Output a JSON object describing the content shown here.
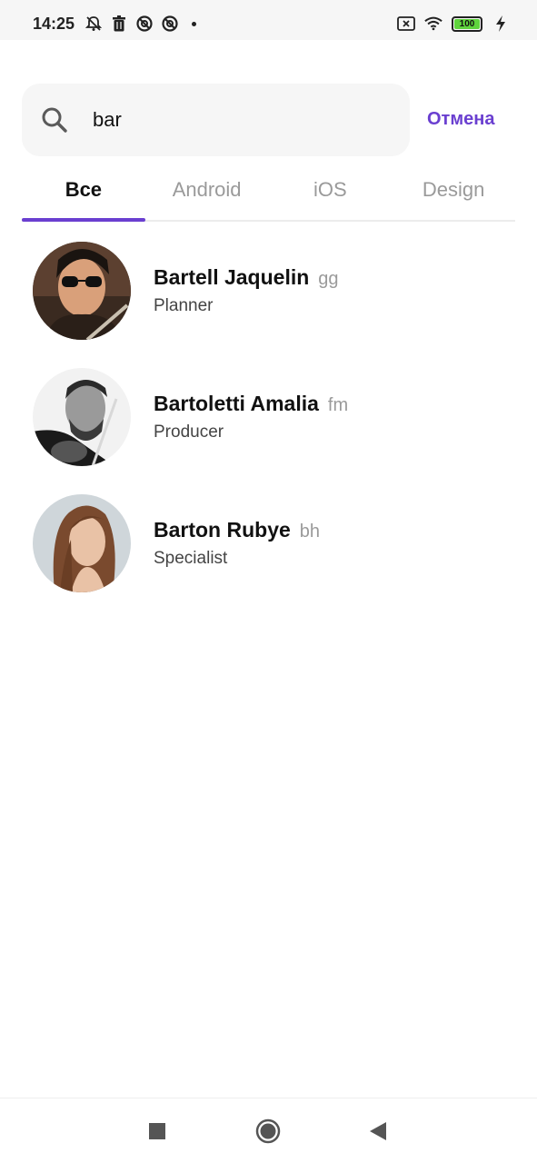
{
  "status_bar": {
    "time": "14:25",
    "battery_level": "100",
    "left_icons": [
      "bell-off-icon",
      "trash-icon",
      "notification-icon",
      "notification-icon"
    ],
    "right_icons": [
      "sim-off-icon",
      "wifi-icon",
      "battery-icon",
      "charging-icon"
    ]
  },
  "search": {
    "value": "bar",
    "cancel_label": "Отмена"
  },
  "tabs": [
    {
      "label": "Все",
      "active": true
    },
    {
      "label": "Android",
      "active": false
    },
    {
      "label": "iOS",
      "active": false
    },
    {
      "label": "Design",
      "active": false
    }
  ],
  "contacts": [
    {
      "name": "Bartell Jaquelin",
      "handle": "gg",
      "role": "Planner"
    },
    {
      "name": "Bartoletti Amalia",
      "handle": "fm",
      "role": "Producer"
    },
    {
      "name": "Barton Rubye",
      "handle": "bh",
      "role": "Specialist"
    }
  ],
  "colors": {
    "accent": "#6a3fd0",
    "search_bg": "#f6f6f6",
    "muted_text": "#9a9a9a"
  },
  "nav_bar": {
    "buttons": [
      "recents-square-icon",
      "home-circle-icon",
      "back-triangle-icon"
    ]
  }
}
